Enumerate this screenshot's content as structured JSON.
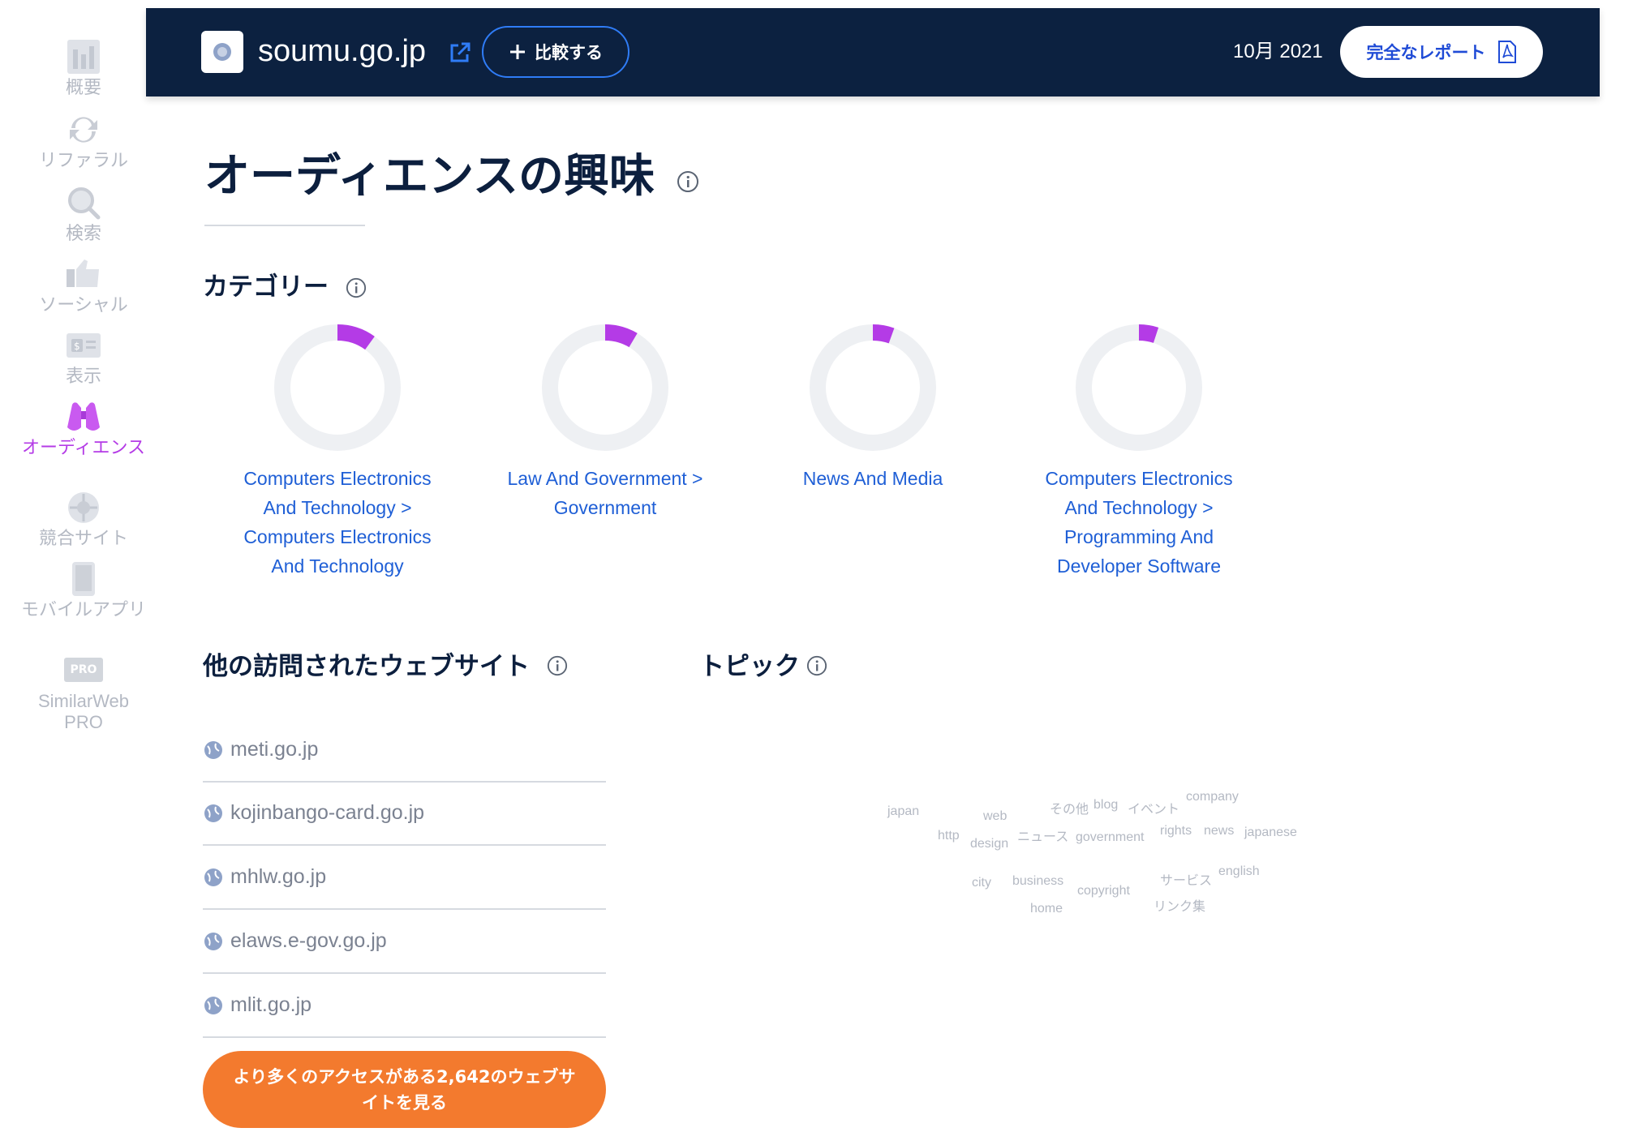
{
  "sidebar": {
    "items": [
      {
        "label": "概要",
        "icon": "overview-icon"
      },
      {
        "label": "リファラル",
        "icon": "referrals-icon"
      },
      {
        "label": "検索",
        "icon": "search-icon"
      },
      {
        "label": "ソーシャル",
        "icon": "social-thumbs-up-icon"
      },
      {
        "label": "表示",
        "icon": "display-ads-icon"
      },
      {
        "label": "オーディエンス",
        "icon": "audience-binoculars-icon",
        "active": true
      },
      {
        "label": "競合サイト",
        "icon": "competitors-icon"
      },
      {
        "label": "モバイルアプリ",
        "icon": "mobile-apps-icon"
      },
      {
        "label": "SimilarWeb PRO",
        "icon": "pro-badge-icon",
        "badge": "PRO"
      }
    ]
  },
  "header": {
    "site_name": "soumu.go.jp",
    "compare_label": "比較する",
    "date": "10月 2021",
    "full_report_label": "完全なレポート"
  },
  "page": {
    "title": "オーディエンスの興味"
  },
  "categories": {
    "heading": "カテゴリー",
    "items": [
      {
        "label": "Computers Electronics And Technology > Computers Electronics And Technology",
        "share": 0.1
      },
      {
        "label": "Law And Government > Government",
        "share": 0.085
      },
      {
        "label": "News And Media",
        "share": 0.055
      },
      {
        "label": "Computers Electronics And Technology > Programming And Developer Software",
        "share": 0.05
      }
    ]
  },
  "other_sites": {
    "heading": "他の訪問されたウェブサイト",
    "sites": [
      "meti.go.jp",
      "kojinbango-card.go.jp",
      "mhlw.go.jp",
      "elaws.e-gov.go.jp",
      "mlit.go.jp"
    ],
    "more_label": "より多くのアクセスがある2,642のウェブサイトを見る"
  },
  "topics": {
    "heading": "トピック",
    "words": [
      "japan",
      "web",
      "その他",
      "blog",
      "イベント",
      "company",
      "http",
      "design",
      "ニュース",
      "government",
      "rights",
      "news",
      "japanese",
      "city",
      "business",
      "copyright",
      "サービス",
      "english",
      "home",
      "リンク集"
    ]
  },
  "colors": {
    "header_bg": "#0c2140",
    "accent_purple": "#b43be6",
    "link_blue": "#1f5fd6",
    "cta_orange": "#f37a2e"
  }
}
